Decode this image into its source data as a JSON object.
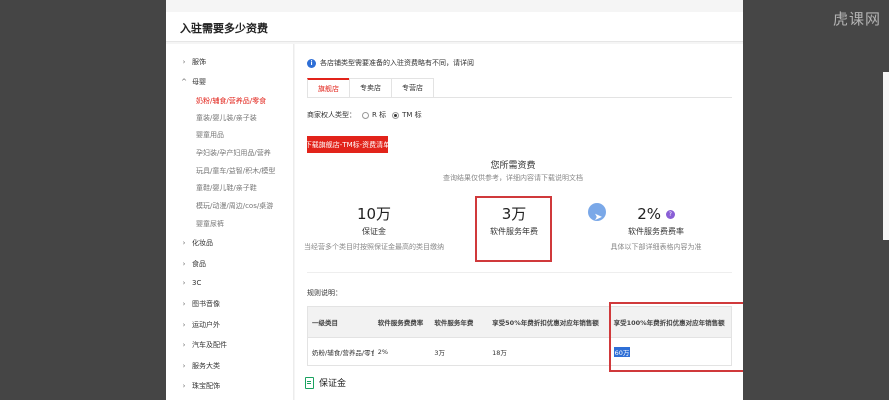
{
  "watermark": "虎课网",
  "header": {
    "title": "入驻需要多少资费"
  },
  "sidebar": {
    "items": [
      {
        "label": "服饰",
        "expanded": false
      },
      {
        "label": "母婴",
        "expanded": true
      },
      {
        "label": "化妆品",
        "expanded": false
      },
      {
        "label": "食品",
        "expanded": false
      },
      {
        "label": "3C",
        "expanded": false
      },
      {
        "label": "图书音像",
        "expanded": false
      },
      {
        "label": "运动户外",
        "expanded": false
      },
      {
        "label": "汽车及配件",
        "expanded": false
      },
      {
        "label": "服务大类",
        "expanded": false
      },
      {
        "label": "珠宝配饰",
        "expanded": false
      }
    ],
    "subitems": [
      "奶粉/辅食/营养品/零食",
      "童装/婴儿装/亲子装",
      "婴童用品",
      "孕妇装/孕产妇用品/营养",
      "玩具/童车/益智/积木/模型",
      "童鞋/婴儿鞋/亲子鞋",
      "模玩/动漫/周边/cos/桌游",
      "婴童尿裤"
    ]
  },
  "main": {
    "notice": "各店铺类型需要准备的入驻资费略有不同，请详阅",
    "tabs": [
      "旗舰店",
      "专卖店",
      "专营店"
    ],
    "rights_label": "商家权人类型：",
    "radio_r": "R 标",
    "radio_tm": "TM 标",
    "download_button": "下载旗舰店-TM标-资费清单",
    "fees_title": "您所需资费",
    "fees_subtitle": "查询结果仅供参考，详细内容请下载说明文档",
    "fees": [
      {
        "value": "10万",
        "label": "保证金",
        "desc": "当经营多个类目时按照保证金最高的类目缴纳"
      },
      {
        "value": "3万",
        "label": "软件服务年费",
        "desc": ""
      },
      {
        "value": "2%",
        "label": "软件服务费费率",
        "desc": "具体以下部详细表格内容为准"
      }
    ],
    "rules_label": "规则说明：",
    "table": {
      "headers": [
        "一级类目",
        "软件服务费费率",
        "软件服务年费",
        "享受50%年费折扣优惠对应年销售额",
        "享受100%年费折扣优惠对应年销售额"
      ],
      "rows": [
        [
          "奶粉/辅食/营养品/零食",
          "2%",
          "3万",
          "18万",
          "60万"
        ]
      ]
    },
    "section_deposit": "保证金"
  }
}
